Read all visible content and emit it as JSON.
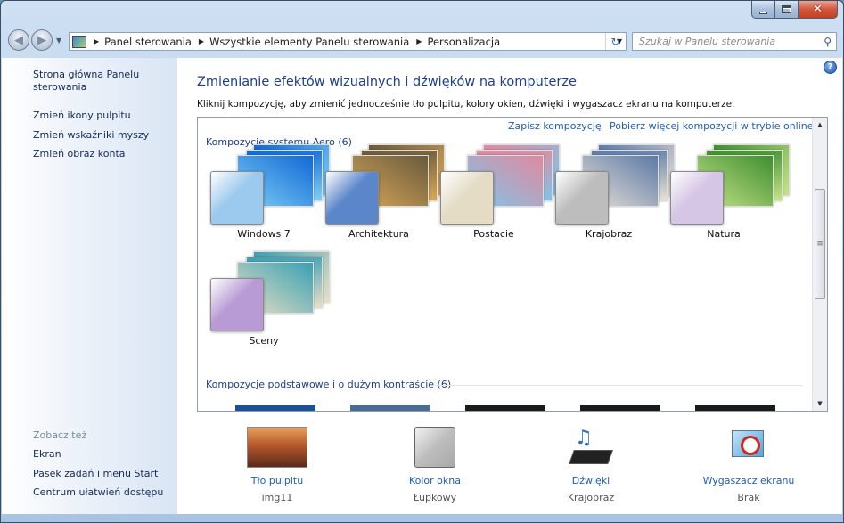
{
  "breadcrumb": [
    "Panel sterowania",
    "Wszystkie elementy Panelu sterowania",
    "Personalizacja"
  ],
  "search": {
    "placeholder": "Szukaj w Panelu sterowania"
  },
  "sidebar": {
    "links": [
      "Strona główna Panelu sterowania",
      "Zmień ikony pulpitu",
      "Zmień wskaźniki myszy",
      "Zmień obraz konta"
    ],
    "see_also_header": "Zobacz też",
    "see_also": [
      "Ekran",
      "Pasek zadań i menu Start",
      "Centrum ułatwień dostępu"
    ]
  },
  "main": {
    "title": "Zmienianie efektów wizualnych i dźwięków na komputerze",
    "subtitle": "Kliknij kompozycję, aby zmienić jednocześnie tło pulpitu, kolory okien, dźwięki i wygaszacz ekranu na komputerze.",
    "links": {
      "save": "Zapisz kompozycję",
      "more": "Pobierz więcej kompozycji w trybie online"
    },
    "aero_header": "Kompozycje systemu Aero (6)",
    "basic_header": "Kompozycje podstawowe i o dużym kontraście (6)",
    "themes": [
      {
        "name": "Windows 7",
        "colors": [
          "#1168d6",
          "#7fd0f5"
        ],
        "chip": "#9cc9ee"
      },
      {
        "name": "Architektura",
        "colors": [
          "#6a5a3c",
          "#d7a85a"
        ],
        "chip": "#5b86c9"
      },
      {
        "name": "Postacie",
        "colors": [
          "#e08aa0",
          "#7fc5e8"
        ],
        "chip": "#e5dcc6"
      },
      {
        "name": "Krajobraz",
        "colors": [
          "#5c7aa8",
          "#e8e0d5"
        ],
        "chip": "#bdbdbd"
      },
      {
        "name": "Natura",
        "colors": [
          "#3f8f2f",
          "#c7e38a"
        ],
        "chip": "#d6c6e6"
      },
      {
        "name": "Sceny",
        "colors": [
          "#3aa0b4",
          "#e9e0c4"
        ],
        "chip": "#b89ad4"
      }
    ]
  },
  "bottom": [
    {
      "label": "Tło pulpitu",
      "value": "img11",
      "icon": "desktop-background-icon"
    },
    {
      "label": "Kolor okna",
      "value": "Łupkowy",
      "icon": "window-color-icon"
    },
    {
      "label": "Dźwięki",
      "value": "Krajobraz",
      "icon": "sounds-icon"
    },
    {
      "label": "Wygaszacz ekranu",
      "value": "Brak",
      "icon": "screensaver-icon"
    }
  ]
}
